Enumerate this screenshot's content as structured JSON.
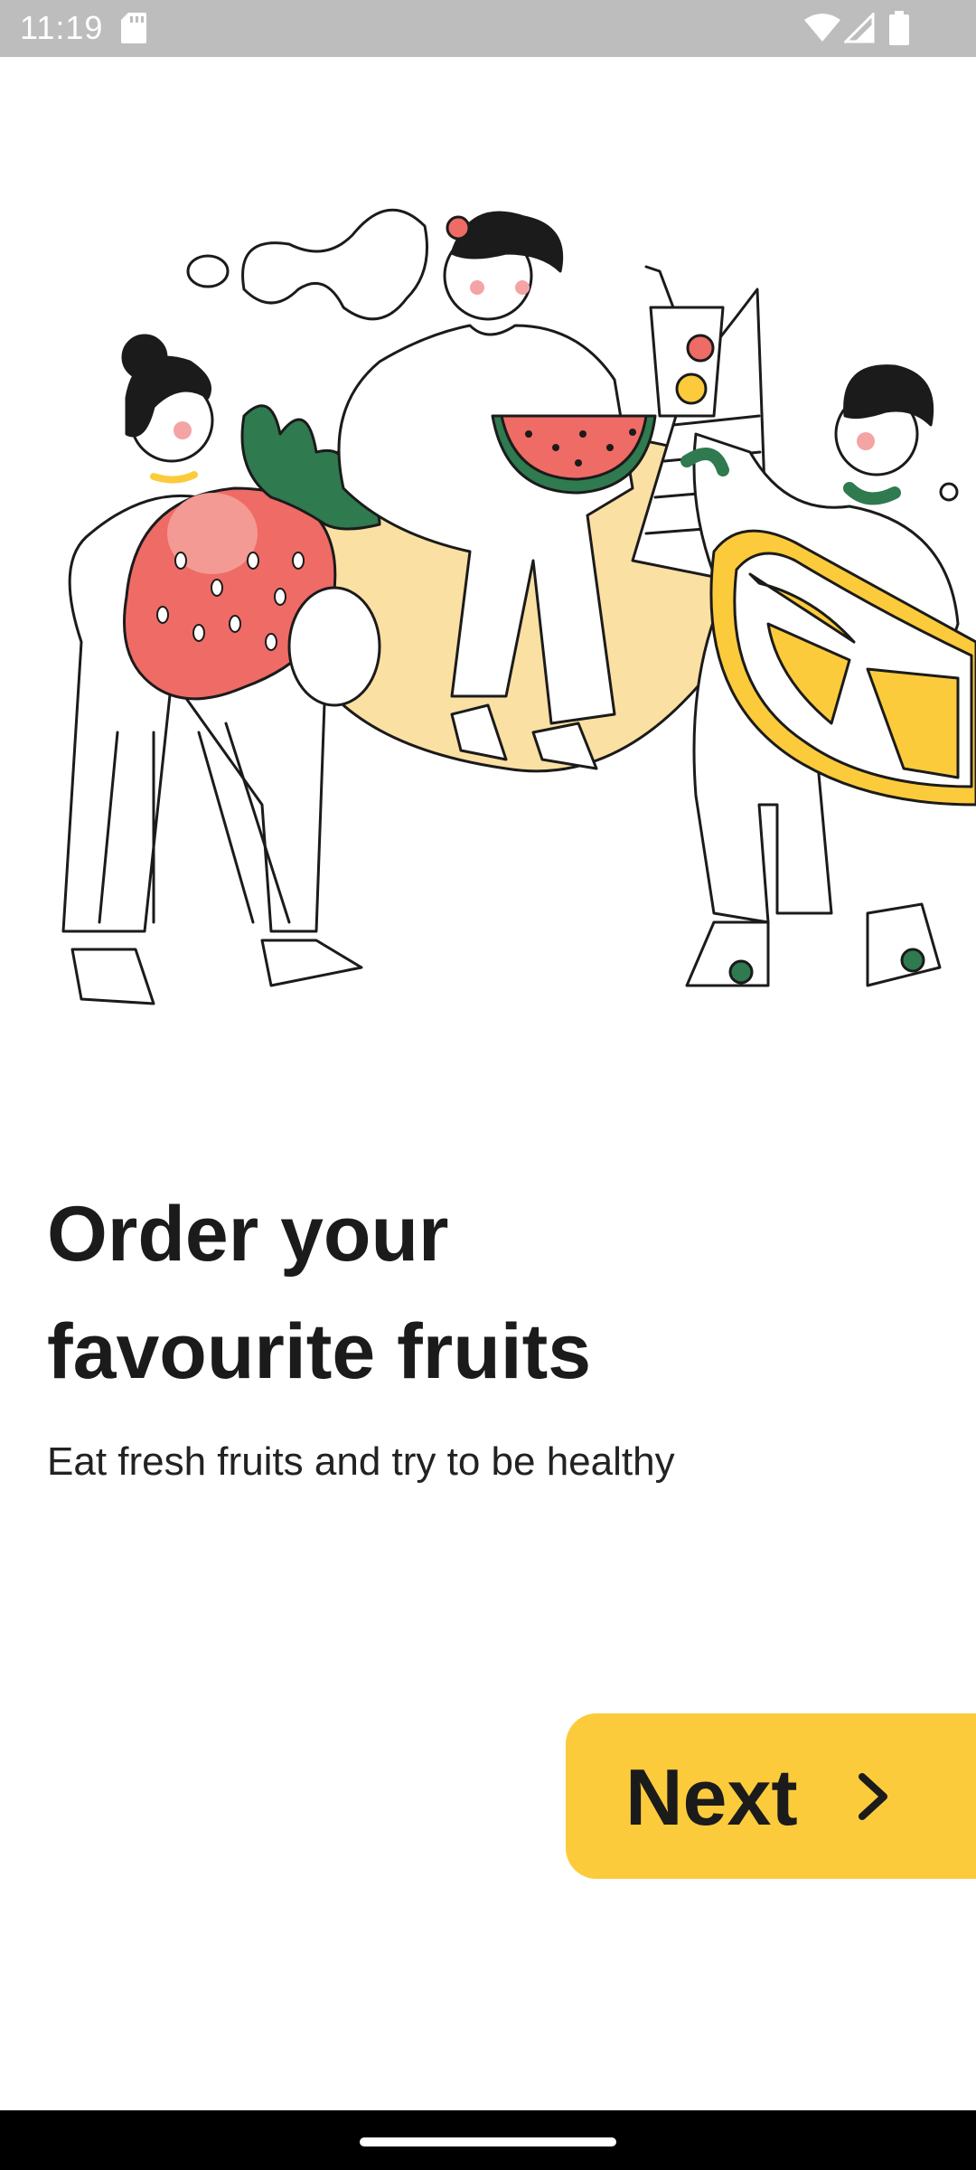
{
  "status_bar": {
    "time": "11:19",
    "icons": [
      "sd-card-icon",
      "wifi-icon",
      "signal-icon",
      "battery-icon"
    ]
  },
  "illustration": {
    "icon": "fruit-people-illustration",
    "colors": {
      "yellow": "#fccb3c",
      "red": "#ef6b66",
      "green": "#2f7a4f",
      "peach": "#fbe0a3"
    }
  },
  "onboarding": {
    "title_line1": "Order your",
    "title_line2": "favourite fruits",
    "subtitle": "Eat fresh fruits and try to be healthy"
  },
  "next_button": {
    "label": "Next",
    "icon": "chevron-right-icon",
    "color": "#fccb3c"
  },
  "nav_bar": {
    "icon": "home-handle"
  }
}
